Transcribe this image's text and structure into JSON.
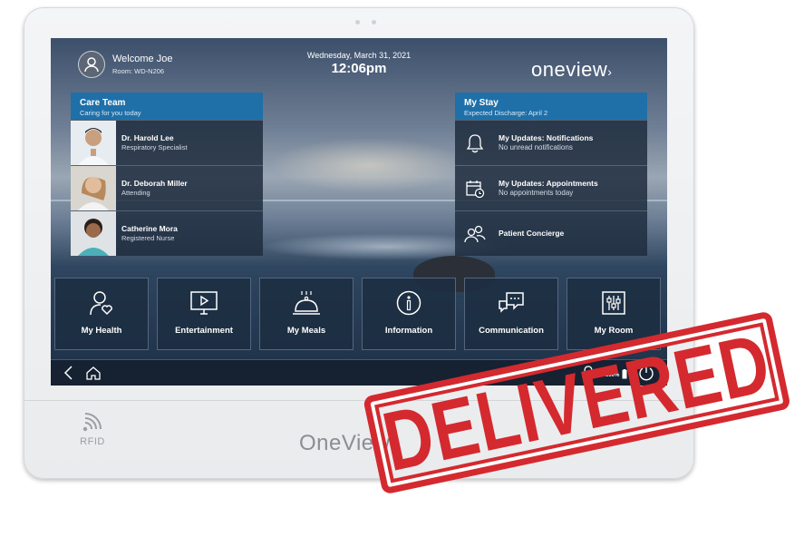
{
  "header": {
    "welcome": "Welcome Joe",
    "room": "Room: WD-N206",
    "date": "Wednesday, March 31, 2021",
    "time": "12:06pm",
    "brand": "oneview"
  },
  "care_team": {
    "title": "Care Team",
    "subtitle": "Caring for you today",
    "members": [
      {
        "name": "Dr. Harold Lee",
        "role": "Respiratory Specialist"
      },
      {
        "name": "Dr. Deborah Miller",
        "role": "Attending"
      },
      {
        "name": "Catherine Mora",
        "role": "Registered Nurse"
      }
    ]
  },
  "my_stay": {
    "title": "My Stay",
    "subtitle": "Expected Discharge: April 2",
    "items": [
      {
        "title": "My Updates: Notifications",
        "sub": "No unread notifications",
        "icon": "bell-icon"
      },
      {
        "title": "My Updates: Appointments",
        "sub": "No appointments today",
        "icon": "calendar-clock-icon"
      },
      {
        "title": "Patient Concierge",
        "sub": "",
        "icon": "people-icon"
      }
    ]
  },
  "tiles": [
    {
      "label": "My Health",
      "icon": "health-person-icon"
    },
    {
      "label": "Entertainment",
      "icon": "tv-play-icon"
    },
    {
      "label": "My Meals",
      "icon": "cloche-icon"
    },
    {
      "label": "Information",
      "icon": "info-icon"
    },
    {
      "label": "Communication",
      "icon": "chat-bubbles-icon"
    },
    {
      "label": "My Room",
      "icon": "sliders-icon"
    }
  ],
  "navbar": {
    "battery": "100%"
  },
  "device": {
    "rfid_label": "RFID",
    "logo": "OneView"
  },
  "stamp": {
    "text": "DELIVERED",
    "color": "#d42a2f"
  },
  "colors": {
    "accent": "#1f6fa8",
    "tile_bg": "#1c2d41"
  }
}
